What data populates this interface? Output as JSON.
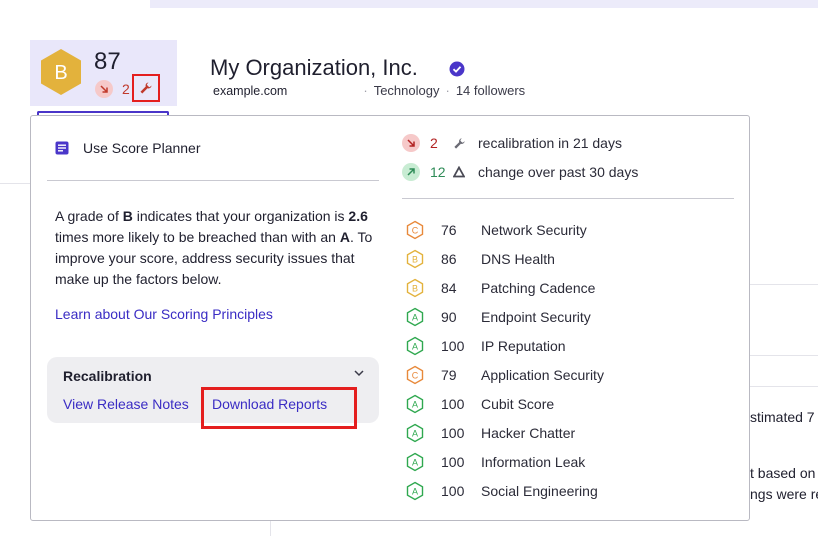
{
  "header": {
    "score": "87",
    "grade": "B",
    "score_change": "2",
    "org_name": "My Organization, Inc.",
    "domain": "example.com",
    "industry": "Technology",
    "followers": "14 followers",
    "meta_sep": "·"
  },
  "popover": {
    "planner_label": "Use Score Planner",
    "explain": {
      "p1": "A grade of ",
      "grade": "B",
      "p2": " indicates that your organization is ",
      "times": "2.6",
      "p3": " times more likely to be breached than with an ",
      "grade_a": "A",
      "p4": ". To improve your score, address security issues that make up the factors below."
    },
    "learn_link": "Learn about Our Scoring Principles",
    "recalibration": {
      "title": "Recalibration",
      "release_notes": "View Release Notes",
      "download_reports": "Download Reports"
    },
    "stats": [
      {
        "value": "2",
        "text": "recalibration in 21 days",
        "color": "#b22222"
      },
      {
        "value": "12",
        "text": "change over past 30 days",
        "color": "#2e8b57"
      }
    ],
    "factors": [
      {
        "grade": "C",
        "score": "76",
        "name": "Network Security"
      },
      {
        "grade": "B",
        "score": "86",
        "name": "DNS Health"
      },
      {
        "grade": "B",
        "score": "84",
        "name": "Patching Cadence"
      },
      {
        "grade": "A",
        "score": "90",
        "name": "Endpoint Security"
      },
      {
        "grade": "A",
        "score": "100",
        "name": "IP Reputation"
      },
      {
        "grade": "C",
        "score": "79",
        "name": "Application Security"
      },
      {
        "grade": "A",
        "score": "100",
        "name": "Cubit Score"
      },
      {
        "grade": "A",
        "score": "100",
        "name": "Hacker Chatter"
      },
      {
        "grade": "A",
        "score": "100",
        "name": "Information Leak"
      },
      {
        "grade": "A",
        "score": "100",
        "name": "Social Engineering"
      }
    ]
  },
  "background": {
    "text1": "stimated 7",
    "text2": "t based on",
    "text3": "ngs were re"
  },
  "colors": {
    "grade_a": "#2fa84f",
    "grade_b": "#e3b23c",
    "grade_c": "#e8893a",
    "accent": "#3a2cc4",
    "highlight": "#e41e1e"
  }
}
